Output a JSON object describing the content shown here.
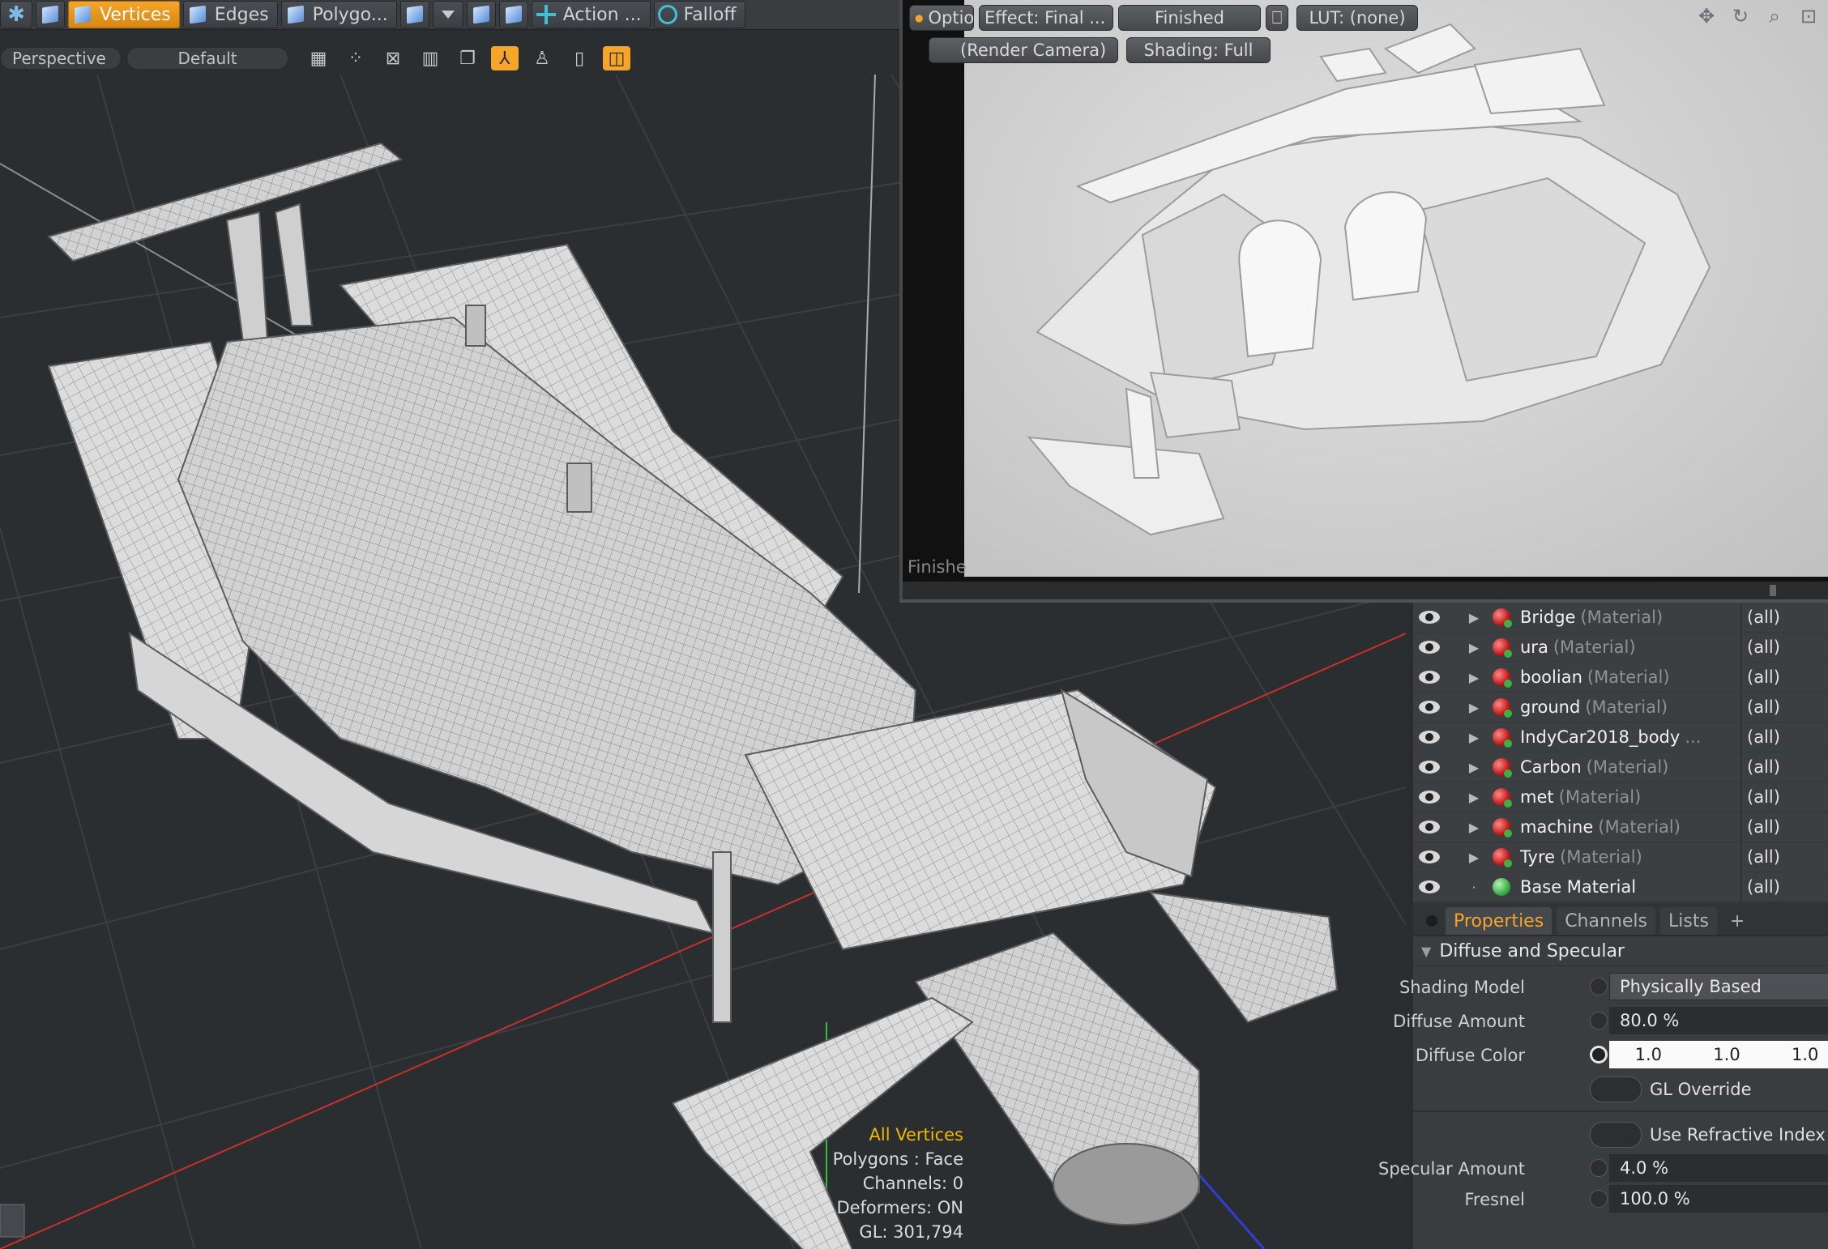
{
  "toolbar": {
    "items": [
      {
        "label": "Vertices",
        "active": true
      },
      {
        "label": "Edges",
        "active": false
      },
      {
        "label": "Polygo...",
        "active": false
      },
      {
        "label": "Action ...",
        "active": false
      },
      {
        "label": "Falloff",
        "active": false
      }
    ]
  },
  "viewport": {
    "projection": "Perspective",
    "style": "Default",
    "hud": {
      "selection": "All Vertices",
      "polygons": "Polygons : Face",
      "channels": "Channels: 0",
      "deformers": "Deformers: ON",
      "gl": "GL: 301,794"
    }
  },
  "render_window": {
    "options_label": "Option...",
    "effect_label": "Effect: Final ...",
    "status_label": "Finished",
    "lut_label": "LUT: (none)",
    "camera_label": "(Render Camera)",
    "shading_label": "Shading: Full",
    "footer_status": "Finishe"
  },
  "shader_tree": {
    "rows": [
      {
        "name": "Bridge",
        "type": "(Material)",
        "effect": "(all)"
      },
      {
        "name": "ura",
        "type": "(Material)",
        "effect": "(all)"
      },
      {
        "name": "boolian",
        "type": "(Material)",
        "effect": "(all)"
      },
      {
        "name": "ground",
        "type": "(Material)",
        "effect": "(all)"
      },
      {
        "name": "IndyCar2018_body",
        "type": "...",
        "effect": "(all)"
      },
      {
        "name": "Carbon",
        "type": "(Material)",
        "effect": "(all)"
      },
      {
        "name": "met",
        "type": "(Material)",
        "effect": "(all)"
      },
      {
        "name": "machine",
        "type": "(Material)",
        "effect": "(all)"
      },
      {
        "name": "Tyre",
        "type": "(Material)",
        "effect": "(all)"
      },
      {
        "name": "Base Material",
        "type": "",
        "effect": "(all)"
      }
    ]
  },
  "properties": {
    "tabs": [
      "Properties",
      "Channels",
      "Lists",
      "+"
    ],
    "section": "Diffuse and Specular",
    "shading_model_label": "Shading Model",
    "shading_model_value": "Physically Based",
    "diffuse_amount_label": "Diffuse Amount",
    "diffuse_amount_value": "80.0 %",
    "diffuse_color_label": "Diffuse Color",
    "diffuse_color_r": "1.0",
    "diffuse_color_g": "1.0",
    "diffuse_color_b": "1.0",
    "gl_override_label": "GL Override",
    "refractive_label": "Use Refractive Index",
    "specular_amount_label": "Specular Amount",
    "specular_amount_value": "4.0 %",
    "fresnel_label": "Fresnel",
    "fresnel_value": "100.0 %"
  },
  "colors": {
    "accent": "#f4a52a",
    "hud_highlight": "#f2b500",
    "viewport_bg": "#2b2e31"
  }
}
